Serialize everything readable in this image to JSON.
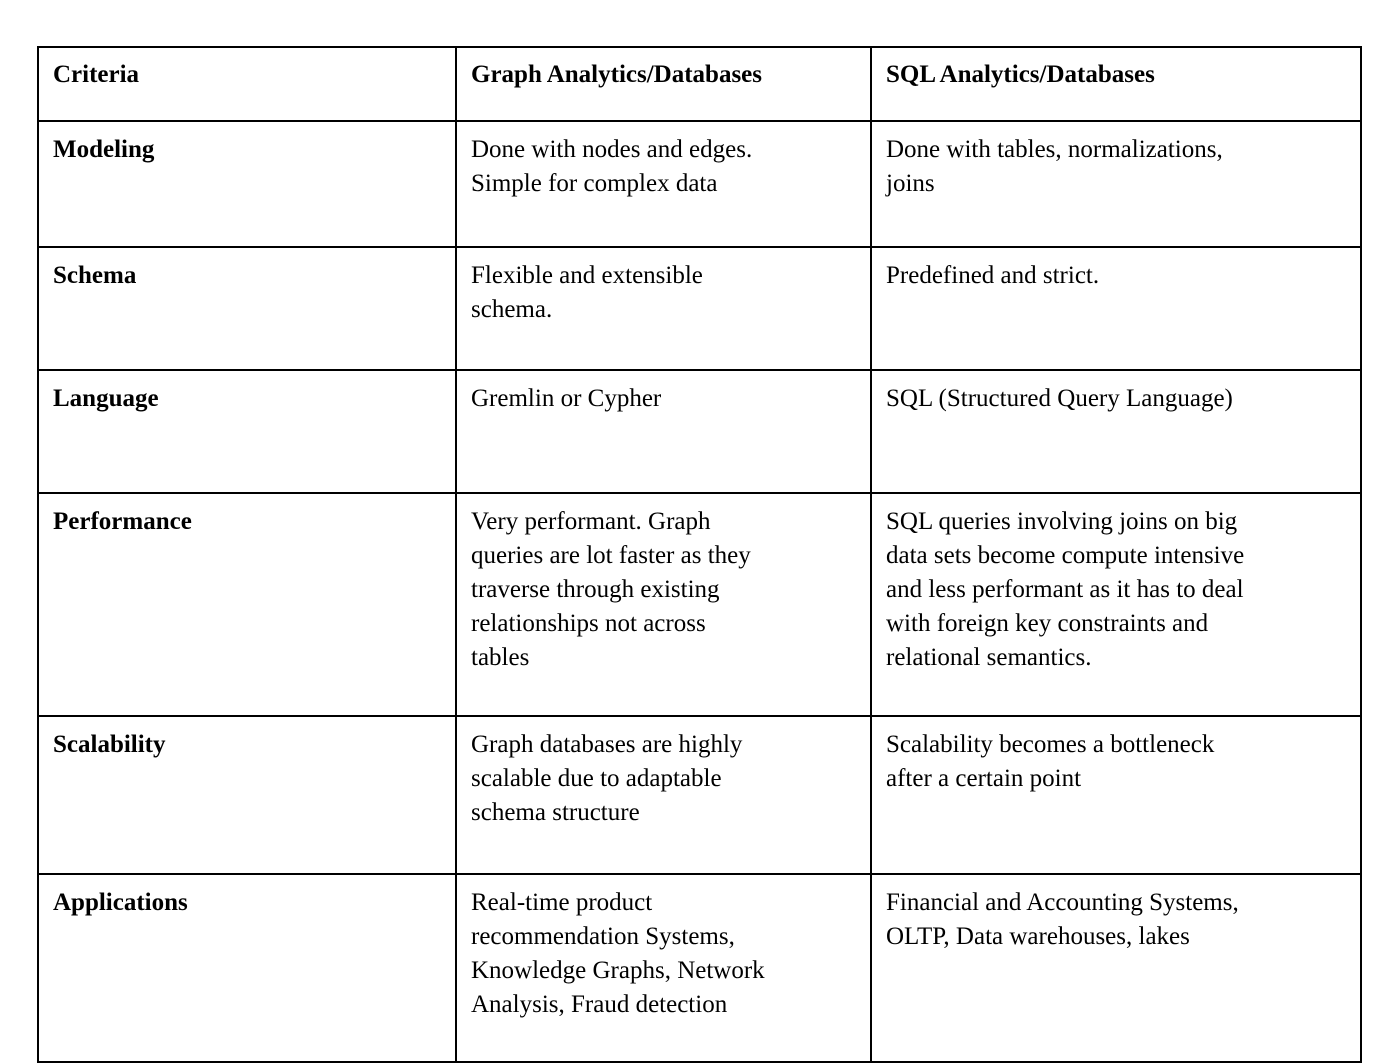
{
  "table": {
    "columns": [
      "Criteria",
      "Graph Analytics/Databases",
      "SQL Analytics/Databases"
    ],
    "rows": [
      {
        "criteria": "Modeling",
        "graph": "Done with nodes and edges.\nSimple for complex data",
        "sql": "Done with tables, normalizations,\njoins"
      },
      {
        "criteria": "Schema",
        "graph": "Flexible and extensible\nschema.",
        "sql": "Predefined and strict."
      },
      {
        "criteria": "Language",
        "graph": "Gremlin or Cypher",
        "sql": "SQL (Structured Query Language)"
      },
      {
        "criteria": "Performance",
        "graph": "Very performant. Graph\nqueries are lot faster as they\ntraverse through existing\nrelationships not across\ntables",
        "sql": "SQL queries involving joins on big\ndata sets become compute intensive\nand less performant as it has to deal\nwith foreign key constraints and\nrelational semantics."
      },
      {
        "criteria": "Scalability",
        "graph": "Graph databases are highly\nscalable due to adaptable\nschema structure",
        "sql": "Scalability becomes a bottleneck\nafter a certain point"
      },
      {
        "criteria": "Applications",
        "graph": "Real-time product\nrecommendation Systems,\nKnowledge Graphs, Network\nAnalysis, Fraud detection",
        "sql": "Financial and Accounting Systems,\nOLTP, Data warehouses, lakes"
      }
    ]
  },
  "colors": {
    "border": "#000000",
    "text": "#000000",
    "background": "#ffffff"
  }
}
